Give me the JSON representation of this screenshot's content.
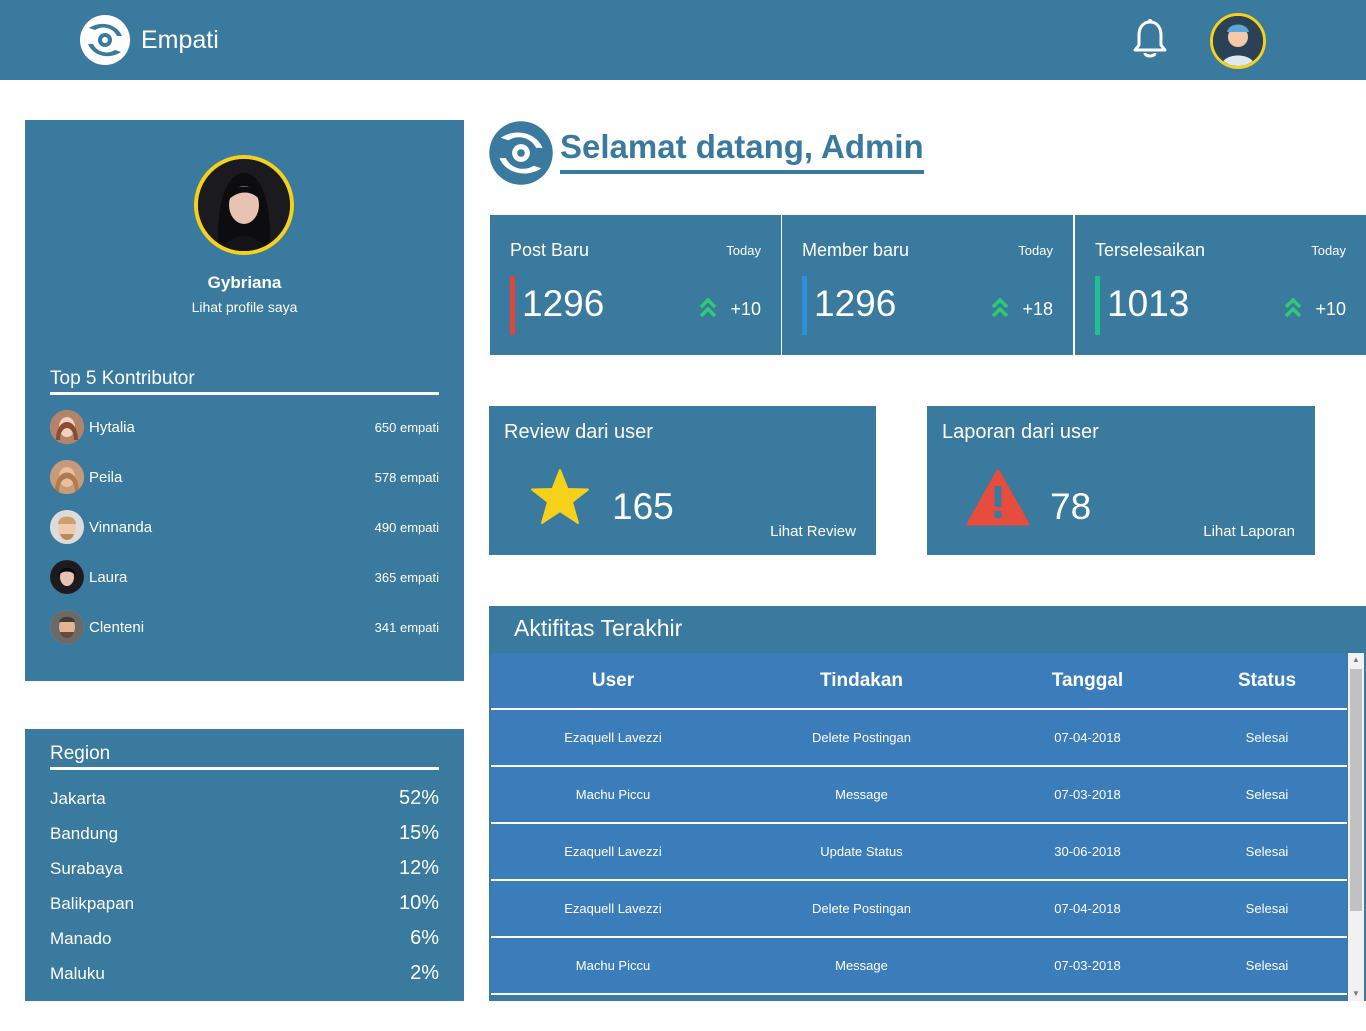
{
  "app": {
    "name": "Empati"
  },
  "profile": {
    "name": "Gybriana",
    "link_label": "Lihat profile saya"
  },
  "contributors": {
    "title": "Top 5 Kontributor",
    "items": [
      {
        "name": "Hytalia",
        "count": "650 empati"
      },
      {
        "name": "Peila",
        "count": "578 empati"
      },
      {
        "name": "Vinnanda",
        "count": "490 empati"
      },
      {
        "name": "Laura",
        "count": "365 empati"
      },
      {
        "name": "Clenteni",
        "count": "341 empati"
      }
    ]
  },
  "region": {
    "title": "Region",
    "items": [
      {
        "name": "Jakarta",
        "percent": "52%"
      },
      {
        "name": "Bandung",
        "percent": "15%"
      },
      {
        "name": "Surabaya",
        "percent": "12%"
      },
      {
        "name": "Balikpapan",
        "percent": "10%"
      },
      {
        "name": "Manado",
        "percent": "6%"
      },
      {
        "name": "Maluku",
        "percent": "2%"
      }
    ]
  },
  "welcome": {
    "title": "Selamat datang, Admin"
  },
  "stats": [
    {
      "label": "Post Baru",
      "period": "Today",
      "value": "1296",
      "delta": "+10",
      "accent": "#e0443b"
    },
    {
      "label": "Member baru",
      "period": "Today",
      "value": "1296",
      "delta": "+18",
      "accent": "#2f8fd8"
    },
    {
      "label": "Terselesaikan",
      "period": "Today",
      "value": "1013",
      "delta": "+10",
      "accent": "#1fbf8f"
    }
  ],
  "review": {
    "title": "Review dari user",
    "value": "165",
    "link_label": "Lihat Review"
  },
  "report": {
    "title": "Laporan dari user",
    "value": "78",
    "link_label": "Lihat Laporan"
  },
  "activity": {
    "title": "Aktifitas Terakhir",
    "columns": [
      "User",
      "Tindakan",
      "Tanggal",
      "Status"
    ],
    "rows": [
      [
        "Ezaquell Lavezzi",
        "Delete Postingan",
        "07-04-2018",
        "Selesai"
      ],
      [
        "Machu Piccu",
        "Message",
        "07-03-2018",
        "Selesai"
      ],
      [
        "Ezaquell Lavezzi",
        "Update Status",
        "30-06-2018",
        "Selesai"
      ],
      [
        "Ezaquell Lavezzi",
        "Delete Postingan",
        "07-04-2018",
        "Selesai"
      ],
      [
        "Machu Piccu",
        "Message",
        "07-03-2018",
        "Selesai"
      ]
    ]
  },
  "colors": {
    "primary": "#3a7a9e",
    "table": "#3b7dba",
    "avatar_ring": "#f6d11a",
    "up_arrow": "#2ecc71",
    "star": "#f6d11a",
    "warning": "#e74c3c"
  }
}
